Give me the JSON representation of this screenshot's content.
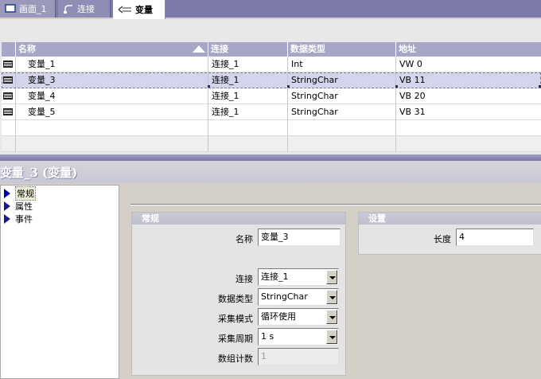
{
  "tabs": [
    {
      "label": "画面_1",
      "icon": "screen-icon"
    },
    {
      "label": "连接",
      "icon": "connection-icon"
    },
    {
      "label": "变量",
      "icon": "tag-icon"
    }
  ],
  "table": {
    "headers": [
      "名称",
      "连接",
      "数据类型",
      "地址"
    ],
    "rows": [
      {
        "name": "变量_1",
        "connection": "连接_1",
        "type": "Int",
        "address": "VW 0"
      },
      {
        "name": "变量_3",
        "connection": "连接_1",
        "type": "StringChar",
        "address": "VB 11",
        "selected": true
      },
      {
        "name": "变量_4",
        "connection": "连接_1",
        "type": "StringChar",
        "address": "VB 20"
      },
      {
        "name": "变量_5",
        "connection": "连接_1",
        "type": "StringChar",
        "address": "VB 31"
      }
    ]
  },
  "properties": {
    "title": "变量_3 (变量)",
    "tree": [
      "常规",
      "属性",
      "事件"
    ],
    "general": {
      "header": "常规",
      "name_label": "名称",
      "name_value": "变量_3",
      "connection_label": "连接",
      "connection_value": "连接_1",
      "datatype_label": "数据类型",
      "datatype_value": "StringChar",
      "acqmode_label": "采集模式",
      "acqmode_value": "循环使用",
      "acqcycle_label": "采集周期",
      "acqcycle_value": "1 s",
      "arraycount_label": "数组计数",
      "arraycount_value": "1"
    },
    "settings": {
      "header": "设置",
      "length_label": "长度",
      "length_value": "4"
    }
  }
}
